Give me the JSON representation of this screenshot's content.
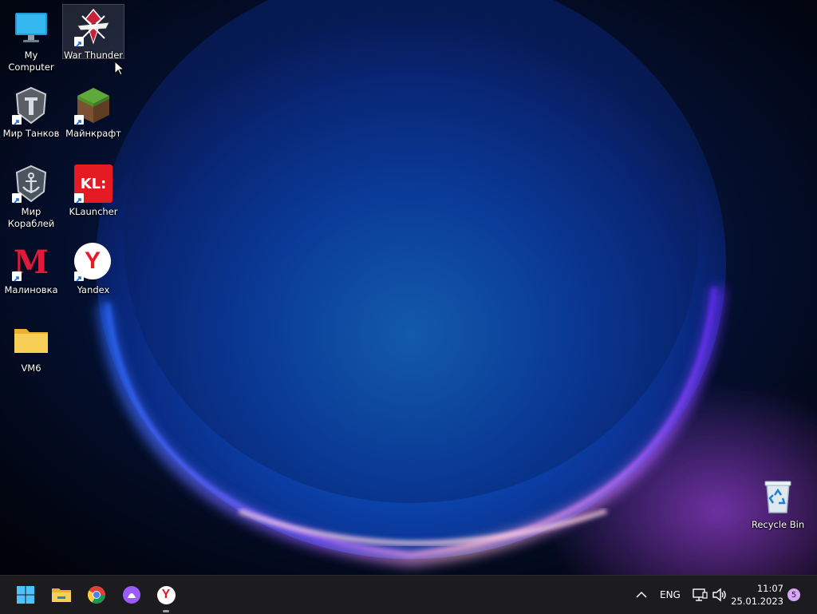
{
  "desktop": {
    "icons": [
      {
        "label": "My Computer",
        "name": "my-computer-icon"
      },
      {
        "label": "War Thunder",
        "name": "war-thunder-icon"
      },
      {
        "label": "Мир Танков",
        "name": "mir-tankov-icon"
      },
      {
        "label": "Майнкрафт",
        "name": "minecraft-icon"
      },
      {
        "label": "Мир Кораблей",
        "name": "mir-korabley-icon"
      },
      {
        "label": "KLauncher",
        "name": "klauncher-icon"
      },
      {
        "label": "Малиновка",
        "name": "malinovka-icon"
      },
      {
        "label": "Yandex",
        "name": "yandex-icon"
      },
      {
        "label": "VM6",
        "name": "folder-icon"
      },
      {
        "label": "Recycle Bin",
        "name": "recycle-bin-icon"
      }
    ],
    "klauncher_logo_text": "KL:",
    "malinovka_logo_text": "M",
    "yandex_logo_text": "Y"
  },
  "taskbar": {
    "apps": [
      {
        "name": "start-button",
        "icon": "windows-logo-icon"
      },
      {
        "name": "file-explorer-button",
        "icon": "folder-icon"
      },
      {
        "name": "chrome-button",
        "icon": "chrome-icon"
      },
      {
        "name": "alice-button",
        "icon": "alice-icon"
      },
      {
        "name": "yandex-browser-button",
        "icon": "yandex-icon"
      }
    ],
    "yandex_glyph": "Y",
    "tray": {
      "chevron": "^",
      "language": "ENG",
      "time": "11:07",
      "date": "25.01.2023",
      "notification_count": "5"
    }
  },
  "colors": {
    "taskbar_bg": "#1c1c1e",
    "accent": "#0078d4"
  }
}
